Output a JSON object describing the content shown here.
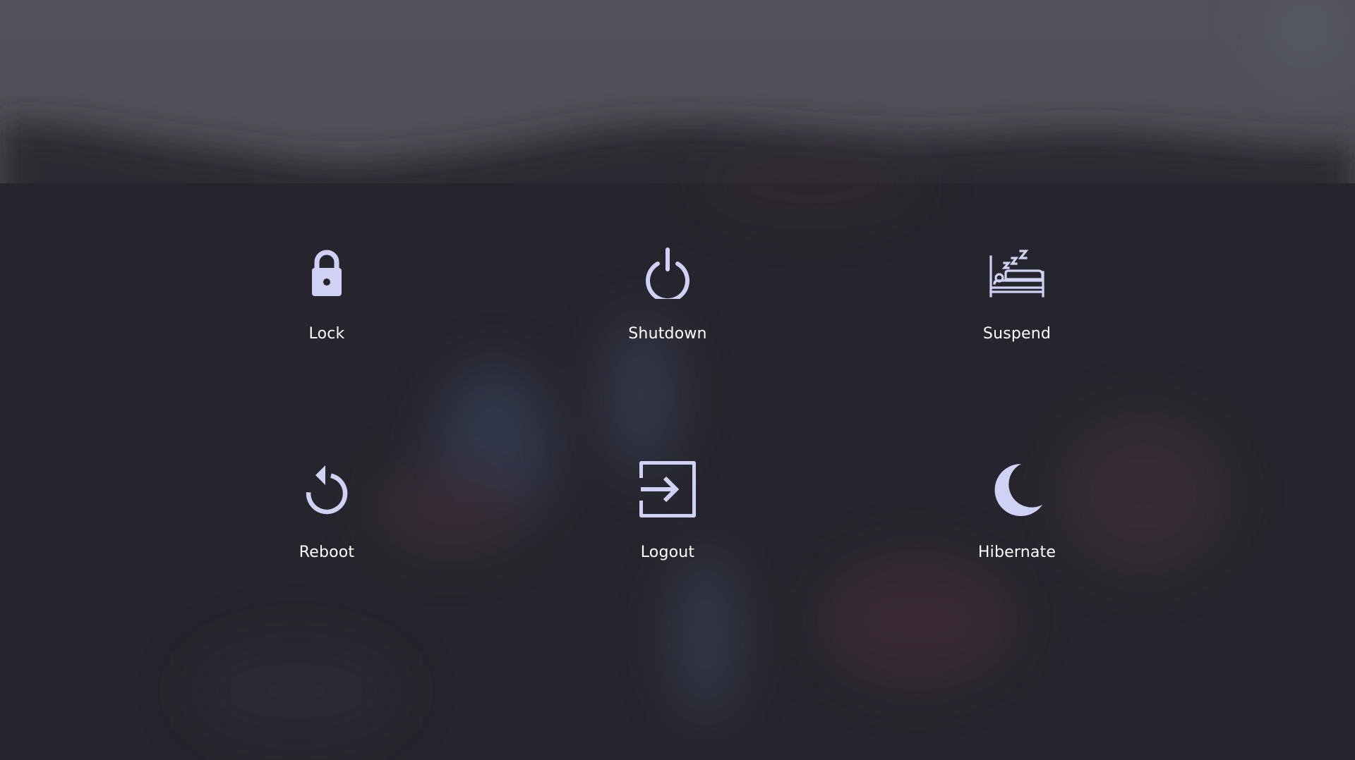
{
  "power_menu": {
    "options": [
      {
        "id": "lock",
        "label": "Lock",
        "icon": "lock-icon"
      },
      {
        "id": "shutdown",
        "label": "Shutdown",
        "icon": "power-icon"
      },
      {
        "id": "suspend",
        "label": "Suspend",
        "icon": "bed-sleep-icon"
      },
      {
        "id": "reboot",
        "label": "Reboot",
        "icon": "restart-icon"
      },
      {
        "id": "logout",
        "label": "Logout",
        "icon": "exit-icon"
      },
      {
        "id": "hibernate",
        "label": "Hibernate",
        "icon": "moon-icon"
      }
    ]
  },
  "theme": {
    "icon_color": "#cfd2f4",
    "label_color": "#ffffff",
    "overlay_color": "#23232b"
  }
}
